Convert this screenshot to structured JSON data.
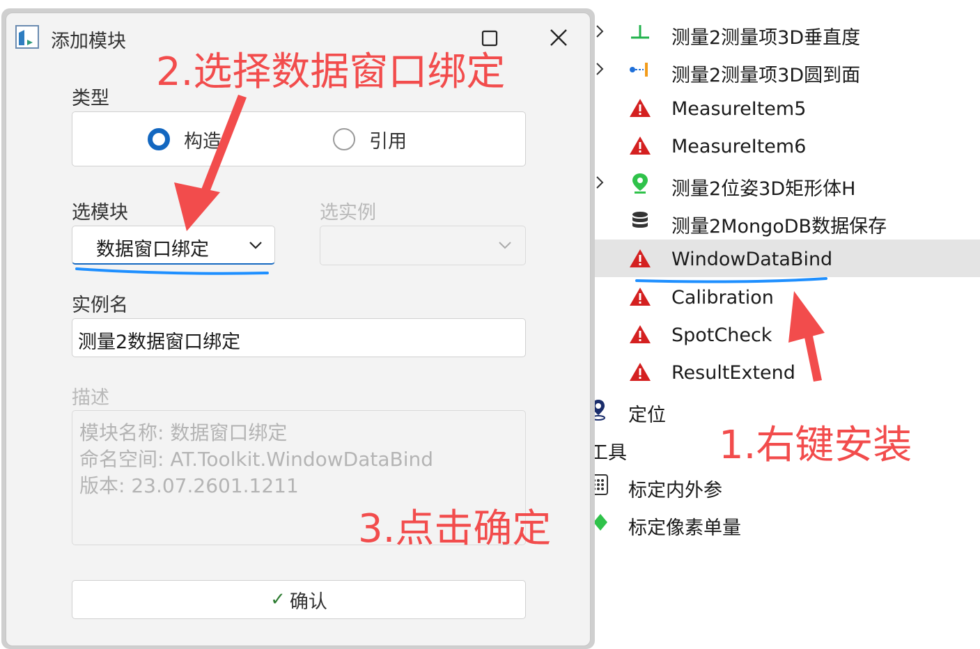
{
  "dialog": {
    "title": "添加模块",
    "type_label": "类型",
    "type_options": [
      {
        "label": "构造",
        "selected": true
      },
      {
        "label": "引用",
        "selected": false
      }
    ],
    "module_label": "选模块",
    "module_value": "数据窗口绑定",
    "instance_label": "选实例",
    "instance_value": "",
    "instance_name_label": "实例名",
    "instance_name_value": "测量2数据窗口绑定",
    "description_label": "描述",
    "description_lines": [
      "模块名称: 数据窗口绑定",
      "命名空间: AT.Toolkit.WindowDataBind",
      "版本: 23.07.2601.1211"
    ],
    "confirm_label": "确认",
    "accent_color": "#1367c0"
  },
  "tree": {
    "items": [
      {
        "label": "测量2测量项3D垂直度",
        "icon": "perpendicular-icon",
        "expandable": true
      },
      {
        "label": "测量2测量项3D圆到面",
        "icon": "circle-to-plane-icon",
        "expandable": true
      },
      {
        "label": "MeasureItem5",
        "icon": "warning-icon",
        "expandable": false
      },
      {
        "label": "MeasureItem6",
        "icon": "warning-icon",
        "expandable": false
      },
      {
        "label": "测量2位姿3D矩形体H",
        "icon": "location-pin-icon",
        "expandable": true
      },
      {
        "label": "测量2MongoDB数据保存",
        "icon": "database-icon",
        "expandable": false
      },
      {
        "label": "WindowDataBind",
        "icon": "warning-icon",
        "expandable": false,
        "selected": true
      },
      {
        "label": "Calibration",
        "icon": "warning-icon",
        "expandable": false
      },
      {
        "label": "SpotCheck",
        "icon": "warning-icon",
        "expandable": false
      },
      {
        "label": "ResultExtend",
        "icon": "warning-icon",
        "expandable": false
      }
    ],
    "groups": [
      {
        "label": "定位",
        "icon": "map-pin-icon"
      },
      {
        "label": "工具",
        "icon": ""
      },
      {
        "label": "标定内外参",
        "icon": "grid-icon"
      },
      {
        "label": "标定像素单量",
        "icon": "diamond-icon"
      }
    ]
  },
  "annotations": {
    "step1": "1.右键安装",
    "step2": "2.选择数据窗口绑定",
    "step3": "3.点击确定",
    "color": "#f24c4c"
  }
}
